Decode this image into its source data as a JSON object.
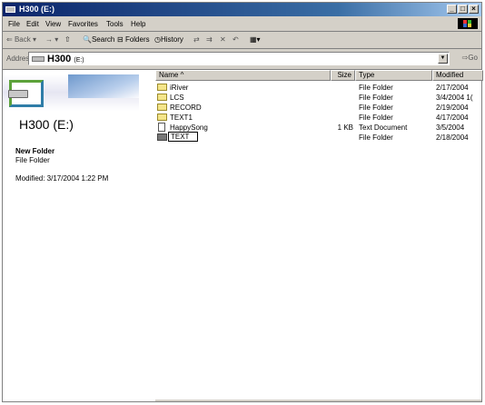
{
  "window": {
    "title_main": "H300",
    "title_drive": "(E:)"
  },
  "menu": [
    "File",
    "Edit",
    "View",
    "Favorites",
    "Tools",
    "Help"
  ],
  "toolbar": {
    "back": "Back",
    "search": "Search",
    "folders": "Folders",
    "history": "History"
  },
  "address": {
    "label": "Address",
    "value_main": "H300",
    "value_drive": "(E:)",
    "go": "Go"
  },
  "leftpane": {
    "drive_title": "H300 (E:)",
    "selected_name": "New Folder",
    "selected_type": "File Folder",
    "selected_modified": "Modified: 3/17/2004 1:22 PM"
  },
  "columns": {
    "name": "Name",
    "size": "Size",
    "type": "Type",
    "modified": "Modified"
  },
  "files": [
    {
      "name": "iRiver",
      "size": "",
      "type": "File Folder",
      "modified": "2/17/2004",
      "icon": "folder-icon"
    },
    {
      "name": "LCS",
      "size": "",
      "type": "File Folder",
      "modified": "3/4/2004 1(",
      "icon": "folder-icon"
    },
    {
      "name": "RECORD",
      "size": "",
      "type": "File Folder",
      "modified": "2/19/2004",
      "icon": "folder-icon"
    },
    {
      "name": "TEXT1",
      "size": "",
      "type": "File Folder",
      "modified": "4/17/2004",
      "icon": "folder-icon"
    },
    {
      "name": "HappySong",
      "size": "1 KB",
      "type": "Text Document",
      "modified": "3/5/2004",
      "icon": "text-document-icon"
    },
    {
      "name": "TEXT",
      "size": "",
      "type": "File Folder",
      "modified": "2/18/2004",
      "icon": "folder-icon"
    }
  ]
}
